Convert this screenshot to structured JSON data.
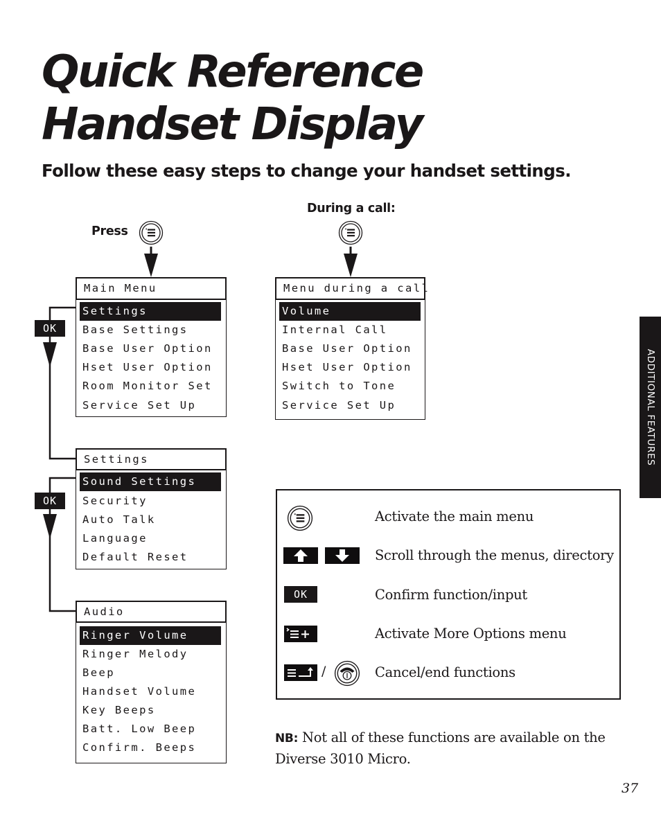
{
  "header": {
    "title_line1": "Quick Reference",
    "title_line2": "Handset Display",
    "subtitle": "Follow these easy steps to change your handset settings."
  },
  "labels": {
    "press": "Press",
    "during_call": "During a call:",
    "ok": "OK"
  },
  "icons": {
    "menu_button": "menu-button-icon",
    "arrow_down": "arrow-down-icon",
    "scroll_up": "scroll-up-key-icon",
    "scroll_down": "scroll-down-key-icon",
    "ok_key": "ok-key-icon",
    "more_options": "more-options-key-icon",
    "back_key": "back-key-icon",
    "end_call": "end-call-button-icon"
  },
  "menus": {
    "main_menu": {
      "title": "Main Menu",
      "items": [
        "Settings",
        "Base Settings",
        "Base User Option",
        "Hset User Option",
        "Room Monitor Set",
        "Service Set Up"
      ],
      "selected_index": 0
    },
    "call_menu": {
      "title": "Menu during a call",
      "items": [
        "Volume",
        "Internal Call",
        "Base User Option",
        "Hset User Option",
        "Switch to Tone",
        "Service Set Up"
      ],
      "selected_index": 0
    },
    "settings_menu": {
      "title": "Settings",
      "items": [
        "Sound Settings",
        "Security",
        "Auto Talk",
        "Language",
        "Default Reset"
      ],
      "selected_index": 0
    },
    "audio_menu": {
      "title": "Audio",
      "items": [
        "Ringer Volume",
        "Ringer Melody",
        "Beep",
        "Handset Volume",
        "Key Beeps",
        "Batt. Low Beep",
        "Confirm. Beeps"
      ],
      "selected_index": 0
    }
  },
  "legend": {
    "rows": [
      {
        "icon": "menu-button-icon",
        "text": "Activate the main menu"
      },
      {
        "icon": "scroll-keys-icon",
        "text": "Scroll through the menus, directory"
      },
      {
        "icon": "ok-key-icon",
        "text": "Confirm function/input"
      },
      {
        "icon": "more-options-key-icon",
        "text": "Activate More Options menu"
      },
      {
        "icon": "back-and-end-call-icon",
        "text": "Cancel/end functions",
        "separator": "/"
      }
    ]
  },
  "side_tab": {
    "label": "ADDITIONAL FEATURES"
  },
  "note": {
    "prefix": "NB:",
    "text": " Not all of these functions are available on the Diverse 3010 Micro."
  },
  "page_number": "37",
  "colors": {
    "ink": "#1a1718",
    "paper": "#ffffff"
  }
}
